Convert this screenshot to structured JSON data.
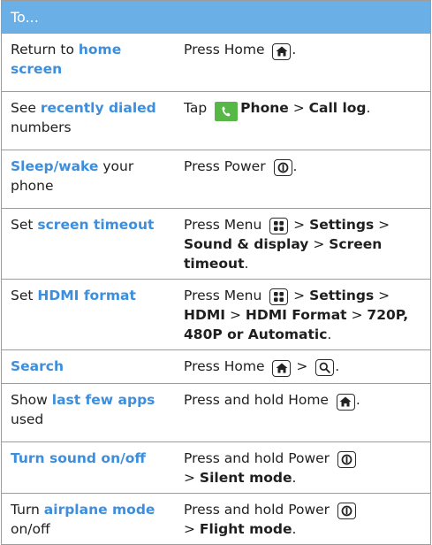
{
  "header": {
    "title": "To..."
  },
  "rows": [
    {
      "c1": {
        "a": "Return to ",
        "b": "home screen"
      },
      "c2": {
        "pre": "Press Home ",
        "post": "."
      }
    },
    {
      "c1": {
        "a": "See ",
        "b": "recently dialed",
        "c": " numbers"
      },
      "c2": {
        "pre": "Tap ",
        "phone": "Phone",
        "sep": " > ",
        "log": "Call log",
        "post": "."
      }
    },
    {
      "c1": {
        "b": "Sleep/wake",
        "c": " your phone"
      },
      "c2": {
        "pre": "Press Power ",
        "post": "."
      }
    },
    {
      "c1": {
        "a": "Set ",
        "b": "screen timeout"
      },
      "c2": {
        "pre": "Press Menu ",
        "s1": " > ",
        "settings": "Settings",
        "s2": " > ",
        "sound": "Sound & display",
        "s3": " > ",
        "timeout": "Screen timeout",
        "post": "."
      }
    },
    {
      "c1": {
        "a": "Set ",
        "b": "HDMI format"
      },
      "c2": {
        "pre": "Press Menu ",
        "s1": " > ",
        "settings": "Settings",
        "s2": " > ",
        "hdmi": "HDMI",
        "s3": " > ",
        "format": "HDMI Format",
        "s4": " > ",
        "options": "720P, 480P or Automatic",
        "post": "."
      }
    },
    {
      "c1": {
        "b": "Search"
      },
      "c2": {
        "pre": "Press Home ",
        "sep": " > ",
        "post": "."
      }
    },
    {
      "c1": {
        "a": "Show ",
        "b": "last few apps",
        "c": " used"
      },
      "c2": {
        "pre": "Press and hold Home ",
        "post": "."
      }
    },
    {
      "c1": {
        "b": "Turn sound on/off"
      },
      "c2": {
        "pre": "Press and hold Power ",
        "sep": " > ",
        "mode": "Silent mode",
        "post": "."
      }
    },
    {
      "c1": {
        "a": "Turn ",
        "b": "airplane mode",
        "c": " on/off"
      },
      "c2": {
        "pre": "Press and hold Power ",
        "sep": " > ",
        "mode": "Flight mode",
        "post": "."
      }
    }
  ],
  "colors": {
    "header_bg": "#6ab0e6",
    "highlight": "#3d8edc",
    "phone_icon": "#57b847",
    "border": "#9c9c9c"
  },
  "icons": [
    "home-key-icon",
    "phone-app-icon",
    "power-key-icon",
    "menu-key-icon",
    "search-key-icon"
  ]
}
